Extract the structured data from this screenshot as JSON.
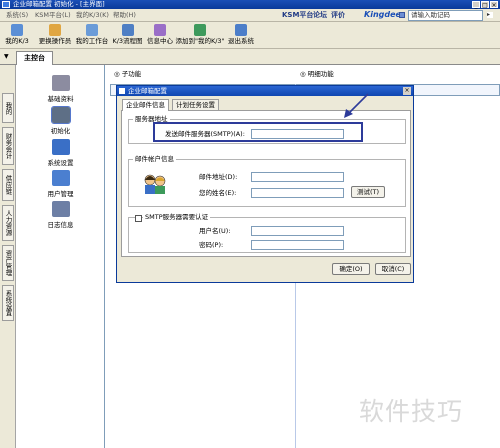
{
  "window": {
    "title": "企业邮箱配置 初始化 - [主界面]",
    "controls": [
      "_",
      "□",
      "×"
    ]
  },
  "menubar": {
    "items": [
      "系统(S)",
      "KSM平台(L)",
      "我的K/3(K)",
      "帮助(H)"
    ],
    "right_links": [
      "KSM平台",
      "论坛",
      "评价"
    ],
    "brand": "Kingdee",
    "search_placeholder": "请输入助记码"
  },
  "toolbar": {
    "items": [
      {
        "label": "我的K/3",
        "icon": "home-icon"
      },
      {
        "label": "更换操作员",
        "icon": "user-switch-icon"
      },
      {
        "label": "我的工作台",
        "icon": "workbench-icon"
      },
      {
        "label": "K/3流程图",
        "icon": "flowchart-icon"
      },
      {
        "label": "信息中心",
        "icon": "message-icon"
      },
      {
        "label": "添加到\"我的K/3\"",
        "icon": "add-favorite-icon"
      },
      {
        "label": "退出系统",
        "icon": "exit-icon"
      }
    ]
  },
  "tabs": {
    "main": "主控台"
  },
  "left_tabs": [
    "我的K/3",
    "财务会计",
    "供应链",
    "人力资源",
    "资产管理",
    "系统设置"
  ],
  "modules": [
    {
      "label": "基础资料",
      "icon": "basic-data-icon"
    },
    {
      "label": "初始化",
      "icon": "initialize-icon",
      "selected": true
    },
    {
      "label": "系统设置",
      "icon": "system-settings-icon"
    },
    {
      "label": "用户管理",
      "icon": "user-management-icon"
    },
    {
      "label": "日志信息",
      "icon": "log-info-icon"
    }
  ],
  "columns": {
    "sub_function": "子功能",
    "detail_function": "明细功能"
  },
  "dialog": {
    "title": "企业邮箱配置",
    "tabs": [
      "企业邮件信息",
      "计划任务设置"
    ],
    "server_group": {
      "title": "服务器地址",
      "smtp_label": "发送邮件服务器(SMTP)(A):",
      "smtp_value": ""
    },
    "account_group": {
      "title": "邮件帐户信息",
      "email_label": "邮件地址(D):",
      "email_value": "",
      "display_name_label": "您的姓名(E):",
      "display_name_value": "",
      "test_button": "测试(T)"
    },
    "auth_group": {
      "checkbox_label": "SMTP服务器需要认证",
      "checked": false,
      "username_label": "用户名(U):",
      "username_value": "",
      "password_label": "密码(P):",
      "password_value": ""
    },
    "ok_button": "确定(O)",
    "cancel_button": "取消(C)"
  },
  "watermark": "软件技巧",
  "colors": {
    "title_bar": "#0a3a9a",
    "highlight_box": "#2d3b9a",
    "annotation_arrow": "#2d3b9a"
  }
}
